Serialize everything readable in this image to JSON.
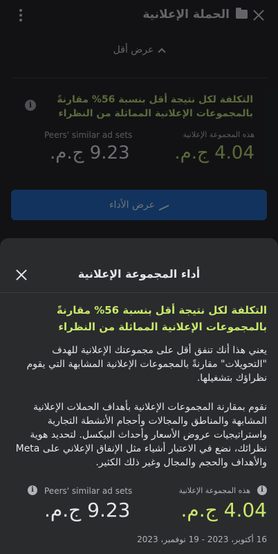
{
  "header": {
    "title": "الحملة الإعلانية",
    "icons": [
      "close-icon",
      "folder-icon",
      "more-vertical-icon"
    ]
  },
  "show_less": {
    "label": "عرض أقل",
    "icon": "chevron-up-icon"
  },
  "summary_card": {
    "headline": "التكلفة لكل نتيجة أقل بنسبة 56% مقارنةً بالمجموعات الإعلانية المماثلة من النظراء",
    "this_label": "هذه المجموعة الإعلانية",
    "peers_label": "Peers' similar ad sets",
    "this_value": "4.04 ج.م.",
    "peers_value": "9.23 ج.م.",
    "icon": "info-icon"
  },
  "performance_button": {
    "label": "عرض الأداء",
    "icon": "trend-icon"
  },
  "sheet": {
    "title": "أداء المجموعة الإعلانية",
    "headline": "التكلفة لكل نتيجة أقل بنسبة 56% مقارنةً بالمجموعات الإعلانية المماثلة من النظراء",
    "paragraph1": "يعني هذا أنك تنفق أقل على مجموعتك الإعلانية للهدف \"التحويلات\" مقارنةً بالمجموعات الإعلانية المشابهة التي يقوم نظراؤك بتشغيلها.",
    "paragraph2": "نقوم بمقارنة المجموعات الإعلانية بأهداف الحملات الإعلانية المشابهة والمناطق والمجالات وأحجام الأنشطة التجارية واستراتيجيات عروض الأسعار وأحداث البيكسل. لتحديد هوية نظرائك، نضع في الاعتبار أشياء مثل الإنفاق الإعلاني على Meta والأهداف والحجم والمجال وغير ذلك الكثير.",
    "this_label": "هذه المجموعة الإعلانية",
    "peers_label": "Peers' similar ad sets",
    "this_value": "4.04 ج.م.",
    "peers_value": "9.23 ج.م.",
    "date_range": "16 أكتوبر، 2023 - 19 نوفمبر، 2023"
  },
  "colors": {
    "accent_green": "#c8e86b",
    "button_blue": "#1d4f8f",
    "sheet_bg": "#2a2b2d"
  }
}
